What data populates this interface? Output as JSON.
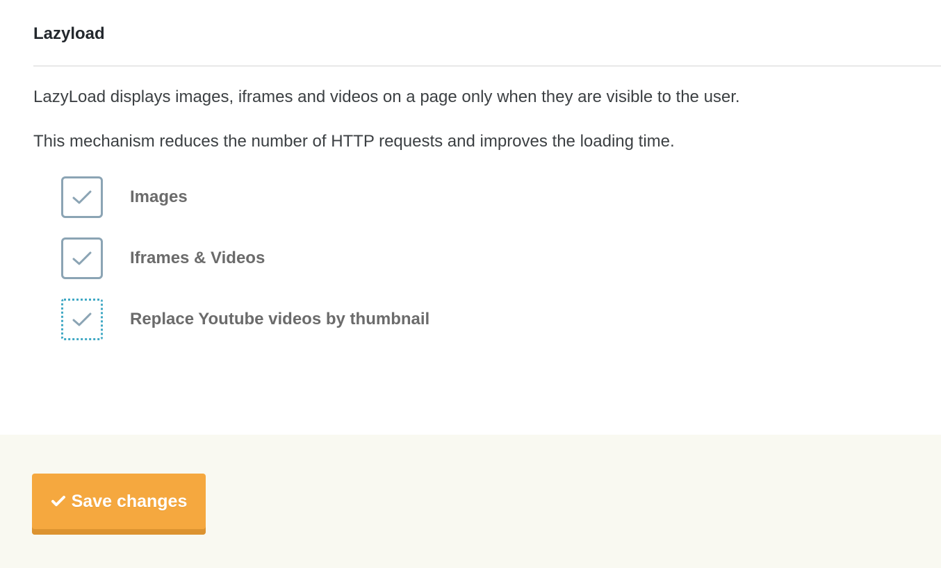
{
  "section": {
    "title": "Lazyload",
    "description_1": "LazyLoad displays images, iframes and videos on a page only when they are visible to the user.",
    "description_2": "This mechanism reduces the number of HTTP requests and improves the loading time."
  },
  "options": [
    {
      "label": "Images",
      "checked": true,
      "icon": "checkmark-icon"
    },
    {
      "label": "Iframes & Videos",
      "checked": true,
      "icon": "checkmark-icon"
    },
    {
      "label": "Replace Youtube videos by thumbnail",
      "checked": true,
      "focused": true,
      "icon": "checkmark-icon"
    }
  ],
  "footer": {
    "save_label": "Save changes",
    "save_icon": "checkmark-icon"
  },
  "colors": {
    "checkbox_border": "#8ba4b4",
    "checkbox_focus_border": "#40a8c4",
    "checkmark": "#8ba4b4",
    "button_bg": "#f5a83f",
    "button_shadow": "#dc9330",
    "footer_bg": "#f9f9f1"
  }
}
